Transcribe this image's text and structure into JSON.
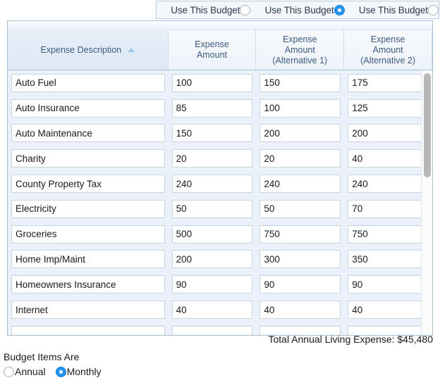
{
  "budget_selector": {
    "options": [
      {
        "label": "Use This Budget",
        "selected": false
      },
      {
        "label": "Use This Budget",
        "selected": true
      },
      {
        "label": "Use This Budget",
        "selected": false
      }
    ]
  },
  "grid": {
    "columns": [
      {
        "header": "Expense Description",
        "sorted": true,
        "sort_direction": "ascending"
      },
      {
        "header": "Expense\nAmount",
        "sorted": false
      },
      {
        "header": "Expense\nAmount\n(Alternative 1)",
        "sorted": false
      },
      {
        "header": "Expense\nAmount\n(Alternative 2)",
        "sorted": false
      }
    ],
    "header_lines": {
      "desc": "Expense Description",
      "amount_l1": "Expense",
      "amount_l2": "Amount",
      "alt1_l1": "Expense",
      "alt1_l2": "Amount",
      "alt1_l3": "(Alternative 1)",
      "alt2_l1": "Expense",
      "alt2_l2": "Amount",
      "alt2_l3": "(Alternative 2)"
    },
    "rows": [
      {
        "description": "Auto Fuel",
        "amount": "100",
        "alt1": "150",
        "alt2": "175"
      },
      {
        "description": "Auto Insurance",
        "amount": "85",
        "alt1": "100",
        "alt2": "125"
      },
      {
        "description": "Auto Maintenance",
        "amount": "150",
        "alt1": "200",
        "alt2": "200"
      },
      {
        "description": "Charity",
        "amount": "20",
        "alt1": "20",
        "alt2": "40"
      },
      {
        "description": "County Property Tax",
        "amount": "240",
        "alt1": "240",
        "alt2": "240"
      },
      {
        "description": "Electricity",
        "amount": "50",
        "alt1": "50",
        "alt2": "70"
      },
      {
        "description": "Groceries",
        "amount": "500",
        "alt1": "750",
        "alt2": "750"
      },
      {
        "description": "Home Imp/Maint",
        "amount": "200",
        "alt1": "300",
        "alt2": "350"
      },
      {
        "description": "Homeowners Insurance",
        "amount": "90",
        "alt1": "90",
        "alt2": "90"
      },
      {
        "description": "Internet",
        "amount": "40",
        "alt1": "40",
        "alt2": "40"
      },
      {
        "description": "",
        "amount": "",
        "alt1": "",
        "alt2": ""
      }
    ]
  },
  "total": {
    "text": "Total Annual Living Expense: $45,480",
    "label": "Total Annual Living Expense:",
    "value": "$45,480"
  },
  "budget_items": {
    "title": "Budget Items Are",
    "options": [
      {
        "label": "Annual",
        "selected": false
      },
      {
        "label": "Monthly",
        "selected": true
      }
    ]
  },
  "colors": {
    "accent": "#2196f3",
    "panel_bg": "#eaf1fa",
    "header_text": "#3c5a80",
    "border": "#a8c0d8"
  }
}
